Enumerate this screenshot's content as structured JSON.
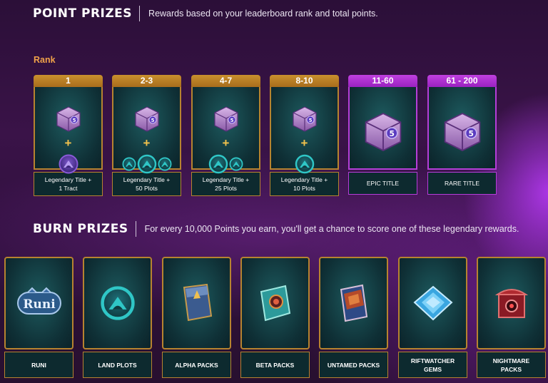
{
  "point_prizes": {
    "title": "POINT PRIZES",
    "subtitle": "Rewards based on your leaderboard rank and total points.",
    "rank_label": "Rank",
    "plus": "+",
    "cards": [
      {
        "rank": "1",
        "label_line1": "Legendary Title +",
        "label_line2": "1 Tract",
        "tier": "gold"
      },
      {
        "rank": "2-3",
        "label_line1": "Legendary Title +",
        "label_line2": "50 Plots",
        "tier": "gold"
      },
      {
        "rank": "4-7",
        "label_line1": "Legendary Title +",
        "label_line2": "25 Plots",
        "tier": "gold"
      },
      {
        "rank": "8-10",
        "label_line1": "Legendary Title +",
        "label_line2": "10 Plots",
        "tier": "gold"
      },
      {
        "rank": "11-60",
        "label_line1": "EPIC TITLE",
        "label_line2": "",
        "tier": "purple"
      },
      {
        "rank": "61 - 200",
        "label_line1": "RARE TITLE",
        "label_line2": "",
        "tier": "purple"
      }
    ]
  },
  "burn_prizes": {
    "title": "BURN PRIZES",
    "subtitle": "For every 10,000 Points you earn, you'll get a chance to score one of these legendary rewards.",
    "runi_logo_text": "Runi",
    "items": [
      {
        "label_line1": "RUNI",
        "label_line2": "",
        "icon": "runi-logo-icon"
      },
      {
        "label_line1": "LAND PLOTS",
        "label_line2": "",
        "icon": "land-plot-icon"
      },
      {
        "label_line1": "ALPHA PACKS",
        "label_line2": "",
        "icon": "alpha-pack-icon"
      },
      {
        "label_line1": "BETA PACKS",
        "label_line2": "",
        "icon": "beta-pack-icon"
      },
      {
        "label_line1": "UNTAMED PACKS",
        "label_line2": "",
        "icon": "untamed-pack-icon"
      },
      {
        "label_line1": "RIFTWATCHER",
        "label_line2": "GEMS",
        "icon": "riftwatcher-gem-icon"
      },
      {
        "label_line1": "NIGHTMARE",
        "label_line2": "PACKS",
        "icon": "nightmare-pack-icon"
      }
    ]
  },
  "colors": {
    "rank_label": "#f0a24a",
    "gold_border": "#b7832f",
    "purple_border": "#b53ed8",
    "plus": "#f2c24c",
    "teal_coin": "#2fc6c6",
    "purple_coin": "#8a5ad8"
  }
}
